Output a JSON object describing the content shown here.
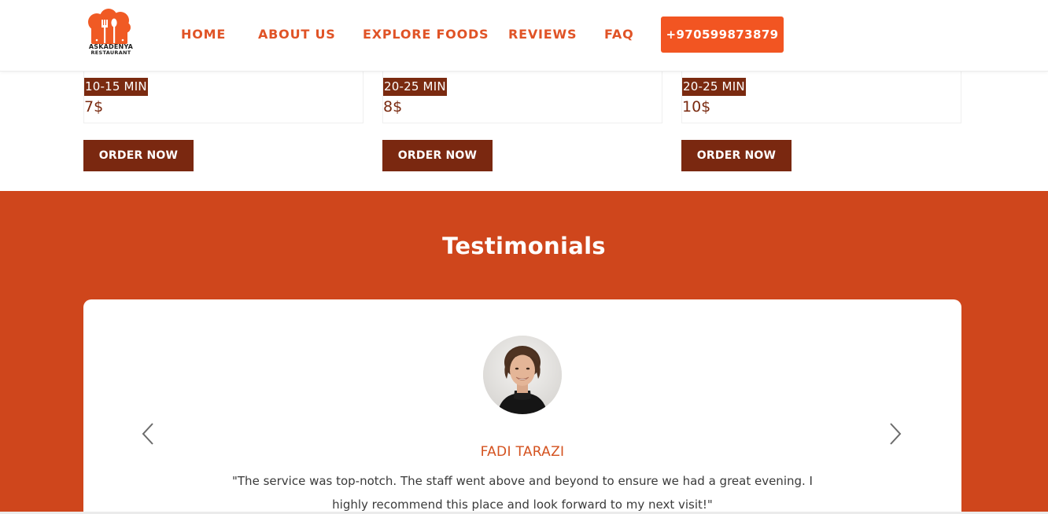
{
  "brand": {
    "name": "ASKADENYA",
    "subtitle": "RESTAURANT",
    "logo_icon": "chef-hat-fork-spoon-icon",
    "accent_color": "#f25522",
    "dark_color": "#7a2810"
  },
  "nav": {
    "items": [
      {
        "label": "HOME"
      },
      {
        "label": "ABOUT US"
      },
      {
        "label": "EXPLORE FOODS"
      },
      {
        "label": "REVIEWS"
      },
      {
        "label": "FAQ"
      }
    ],
    "phone": "+970599873879"
  },
  "products": [
    {
      "time": "10-15 MIN",
      "price": "7$",
      "order_label": "ORDER NOW"
    },
    {
      "time": "20-25 MIN",
      "price": "8$",
      "order_label": "ORDER NOW"
    },
    {
      "time": "20-25 MIN",
      "price": "10$",
      "order_label": "ORDER NOW"
    }
  ],
  "testimonials": {
    "title": "Testimonials",
    "background_color": "#cf461c",
    "prev_icon": "chevron-left-icon",
    "next_icon": "chevron-right-icon",
    "current": {
      "name": "FADI TARAZI",
      "quote": "\"The service was top-notch. The staff went above and beyond to ensure we had a great evening. I highly recommend this place and look forward to my next visit!\""
    }
  }
}
